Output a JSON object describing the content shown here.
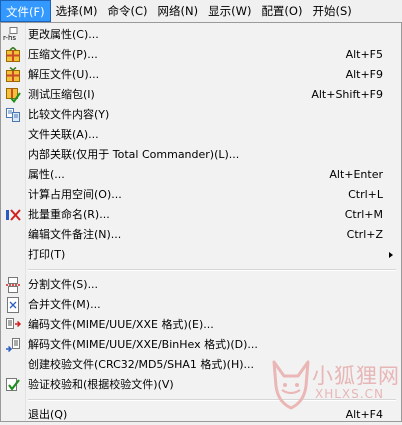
{
  "menubar": {
    "items": [
      {
        "label": "文件(F)",
        "active": true
      },
      {
        "label": "选择(M)"
      },
      {
        "label": "命令(C)"
      },
      {
        "label": "网络(N)"
      },
      {
        "label": "显示(W)"
      },
      {
        "label": "配置(O)"
      },
      {
        "label": "开始(S)"
      }
    ]
  },
  "file_menu": {
    "items": [
      {
        "label": "更改属性(C)...",
        "shortcut": "",
        "icon": "change-attributes-icon",
        "icon_text": "r-hs"
      },
      {
        "label": "压缩文件(P)...",
        "shortcut": "Alt+F5",
        "icon": "pack-archive-icon"
      },
      {
        "label": "解压文件(U)...",
        "shortcut": "Alt+F9",
        "icon": "unpack-archive-icon"
      },
      {
        "label": "测试压缩包(I)",
        "shortcut": "Alt+Shift+F9",
        "icon": "test-archive-icon"
      },
      {
        "label": "比较文件内容(Y)",
        "shortcut": "",
        "icon": "compare-files-icon"
      },
      {
        "label": "文件关联(A)...",
        "shortcut": "",
        "icon": ""
      },
      {
        "label": "内部关联(仅用于 Total Commander)(L)...",
        "shortcut": "",
        "icon": ""
      },
      {
        "label": "属性(...",
        "shortcut": "Alt+Enter",
        "icon": ""
      },
      {
        "label": "计算占用空间(O)...",
        "shortcut": "Ctrl+L",
        "icon": ""
      },
      {
        "label": "批量重命名(R)...",
        "shortcut": "Ctrl+M",
        "icon": "multi-rename-icon"
      },
      {
        "label": "编辑文件备注(N)...",
        "shortcut": "Ctrl+Z",
        "icon": ""
      },
      {
        "label": "打印(T)",
        "shortcut": "",
        "icon": "",
        "submenu": true
      },
      {
        "separator": true
      },
      {
        "label": "分割文件(S)...",
        "shortcut": "",
        "icon": "split-file-icon"
      },
      {
        "label": "合并文件(M)...",
        "shortcut": "",
        "icon": "combine-files-icon"
      },
      {
        "label": "编码文件(MIME/UUE/XXE 格式)(E)...",
        "shortcut": "",
        "icon": "encode-file-icon"
      },
      {
        "label": "解码文件(MIME/UUE/XXE/BinHex 格式)(D)...",
        "shortcut": "",
        "icon": "decode-file-icon"
      },
      {
        "label": "创建校验文件(CRC32/MD5/SHA1 格式)(H)...",
        "shortcut": "",
        "icon": ""
      },
      {
        "label": "验证校验和(根据校验文件)(V)",
        "shortcut": "",
        "icon": "verify-checksum-icon"
      },
      {
        "separator": true
      },
      {
        "label": "退出(Q)",
        "shortcut": "Alt+F4",
        "icon": ""
      }
    ]
  },
  "watermark": {
    "line1": "小狐狸网",
    "line2": "XHLXS.CN"
  },
  "colors": {
    "menubar_active_bg": "#3399ff",
    "menu_bg": "#f2f2f2",
    "watermark": "#e8b6b6"
  }
}
